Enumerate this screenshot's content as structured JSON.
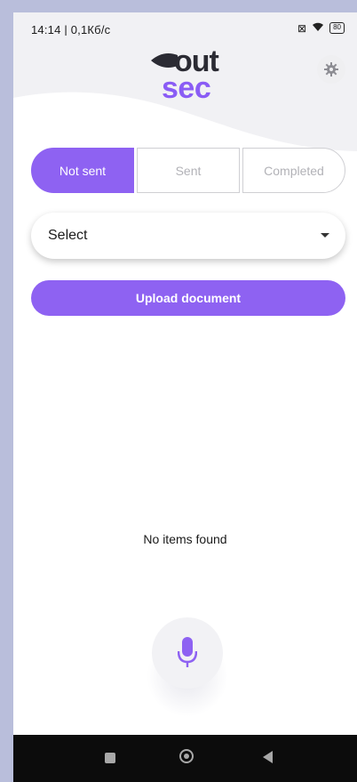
{
  "statusbar": {
    "time_info": "14:14 | 0,1Кб/с",
    "battery": "80"
  },
  "logo": {
    "top": "out",
    "bottom": "sec"
  },
  "tabs": [
    {
      "label": "Not sent",
      "active": true
    },
    {
      "label": "Sent",
      "active": false
    },
    {
      "label": "Completed",
      "active": false
    }
  ],
  "select": {
    "value": "Select"
  },
  "upload": {
    "label": "Upload document"
  },
  "list": {
    "empty_text": "No items found"
  },
  "colors": {
    "accent": "#8e62f2",
    "background": "#ffffff"
  },
  "icons": {
    "settings": "gear-icon",
    "mic": "microphone-icon"
  }
}
